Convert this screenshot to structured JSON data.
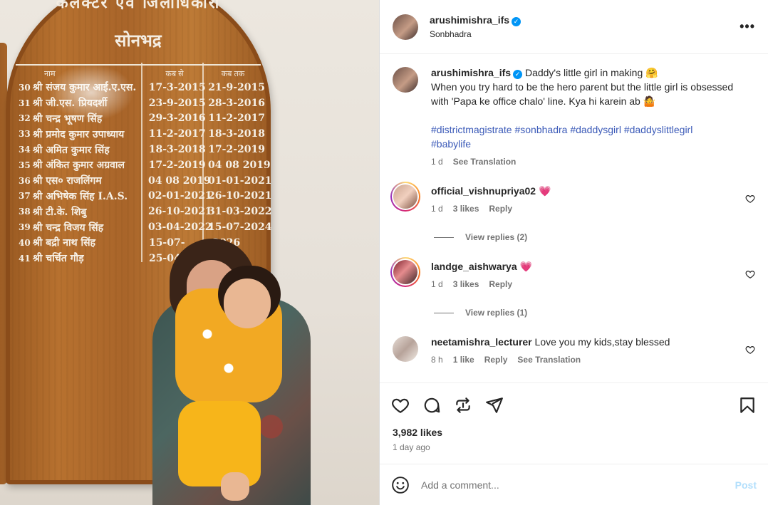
{
  "photo": {
    "board_top_text": "कलेक्टर एवं जिलाधिकारी",
    "board_title": "सोनभद्र",
    "columns": [
      "नाम",
      "कब से",
      "कब तक"
    ],
    "rows": [
      {
        "no": "30",
        "name": "श्री संजय कुमार आई.ए.एस.",
        "from": "17-3-2015",
        "to": "21-9-2015"
      },
      {
        "no": "31",
        "name": "श्री जी.एस. प्रियदर्शी",
        "from": "23-9-2015",
        "to": "28-3-2016"
      },
      {
        "no": "32",
        "name": "श्री चन्द्र भूषण सिंह",
        "from": "29-3-2016",
        "to": "11-2-2017"
      },
      {
        "no": "33",
        "name": "श्री प्रमोद कुमार उपाध्याय",
        "from": "11-2-2017",
        "to": "18-3-2018"
      },
      {
        "no": "34",
        "name": "श्री अमित कुमार सिंह",
        "from": "18-3-2018",
        "to": "17-2-2019"
      },
      {
        "no": "35",
        "name": "श्री अंकित कुमार अग्रवाल",
        "from": "17-2-2019",
        "to": "04 08 2019"
      },
      {
        "no": "36",
        "name": "श्री एस० राजलिंगम",
        "from": "04 08 2019",
        "to": "01-01-2021"
      },
      {
        "no": "37",
        "name": "श्री अभिषेक सिंह I.A.S.",
        "from": "02-01-2021",
        "to": "26-10-2021"
      },
      {
        "no": "38",
        "name": "श्री टी.के. शिबु",
        "from": "26-10-2021",
        "to": "31-03-2022"
      },
      {
        "no": "39",
        "name": "श्री चन्द्र विजय सिंह",
        "from": "03-04-2022",
        "to": "15-07-2024"
      },
      {
        "no": "40",
        "name": "श्री बद्री नाथ सिंह",
        "from": "15-07-",
        "to": "-2026"
      },
      {
        "no": "41",
        "name": "श्री चर्चित गौड़",
        "from": "25-04-",
        "to": ""
      }
    ]
  },
  "header": {
    "username": "arushimishra_ifs",
    "location": "Sonbhadra",
    "more": "•••"
  },
  "caption": {
    "username": "arushimishra_ifs",
    "text": "Daddy's little girl in making 🤗",
    "text2": "When you try hard to be the hero parent but the little girl is obsessed with 'Papa ke office chalo' line. Kya hi karein ab 🤷",
    "hashtags": [
      "#districtmagistrate",
      "#sonbhadra",
      "#daddysgirl",
      "#daddyslittlegirl",
      "#babylife"
    ],
    "time": "1 d",
    "see_translation": "See Translation"
  },
  "comments": [
    {
      "username": "official_vishnupriya02",
      "text": "💗",
      "time": "1 d",
      "likes": "3 likes",
      "reply": "Reply",
      "view_replies": "View replies (2)"
    },
    {
      "username": "landge_aishwarya",
      "text": "💗",
      "time": "1 d",
      "likes": "3 likes",
      "reply": "Reply",
      "view_replies": "View replies (1)"
    },
    {
      "username": "neetamishra_lecturer",
      "text": "Love you my kids,stay blessed",
      "time": "8 h",
      "likes": "1 like",
      "reply": "Reply",
      "see_translation": "See Translation"
    }
  ],
  "footer": {
    "likes": "3,982 likes",
    "ago": "1 day ago",
    "comment_placeholder": "Add a comment...",
    "post_label": "Post"
  },
  "colors": {
    "link": "#3b5ab8",
    "verified": "#0095f6",
    "post_disabled": "#b2dffc"
  }
}
